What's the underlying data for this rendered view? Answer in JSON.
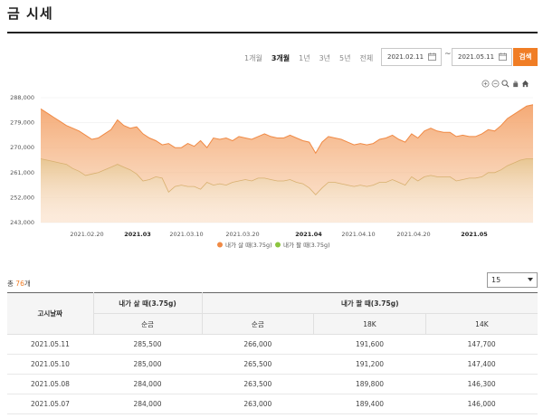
{
  "page": {
    "title": "금 시세"
  },
  "filters": {
    "periods": [
      "1개월",
      "3개월",
      "1년",
      "3년",
      "5년",
      "전체"
    ],
    "active_period": "3개월",
    "start_date": "2021.02.11",
    "end_date": "2021.05.11",
    "separator": "~",
    "search_label": "검색"
  },
  "chart_tools": [
    "zoom-in-icon",
    "zoom-out-icon",
    "magnifier-icon",
    "pan-hand-icon",
    "home-icon"
  ],
  "chart_data": {
    "type": "area",
    "x_tick_labels": [
      "2021.02.20",
      "2021.03",
      "2021.03.10",
      "2021.03.20",
      "2021.04",
      "2021.04.10",
      "2021.04.20",
      "2021.05"
    ],
    "x_tick_bold": [
      false,
      true,
      false,
      false,
      true,
      false,
      false,
      true
    ],
    "y_tick_labels": [
      "288,000",
      "279,000",
      "270,000",
      "261,000",
      "252,000",
      "243,000"
    ],
    "ylim": [
      243000,
      288000
    ],
    "legend_placement": "bottom-center",
    "series": [
      {
        "name": "내가 살 때(3.75g)",
        "color": "#f0a36a",
        "values": [
          284000,
          282500,
          281000,
          279500,
          278000,
          277000,
          276000,
          274500,
          273000,
          273500,
          275000,
          276500,
          280000,
          278000,
          277000,
          277500,
          275000,
          273500,
          272500,
          271000,
          271500,
          270000,
          270000,
          271500,
          270500,
          272500,
          270000,
          273500,
          273000,
          273500,
          272500,
          274000,
          273500,
          273000,
          274000,
          275000,
          274000,
          273500,
          273500,
          274500,
          273500,
          272500,
          272000,
          268000,
          272000,
          274000,
          273500,
          273000,
          272000,
          271000,
          271500,
          271000,
          271500,
          273000,
          273500,
          274500,
          273000,
          272000,
          275000,
          273500,
          276000,
          277000,
          276000,
          275500,
          275500,
          274000,
          274500,
          274000,
          274000,
          275000,
          276500,
          276000,
          278000,
          280500,
          282000,
          283500,
          285000,
          285500
        ]
      },
      {
        "name": "내가 팔 때(3.75g)",
        "color": "#a8d36a",
        "values": [
          266000,
          265500,
          265000,
          264500,
          264000,
          262500,
          261500,
          260000,
          260500,
          261000,
          262000,
          263000,
          264000,
          263000,
          262000,
          260500,
          258000,
          258500,
          259500,
          259000,
          254000,
          256000,
          256500,
          256000,
          256000,
          255000,
          257500,
          256500,
          257000,
          256500,
          257500,
          258000,
          258500,
          258000,
          259000,
          259000,
          258500,
          258000,
          258000,
          258500,
          257500,
          257000,
          255500,
          253000,
          255500,
          257500,
          257500,
          257000,
          256500,
          256000,
          256500,
          256000,
          256500,
          257500,
          257500,
          258500,
          257500,
          256500,
          259500,
          258000,
          259500,
          260000,
          259500,
          259500,
          259500,
          258000,
          258500,
          259000,
          259000,
          259500,
          261000,
          261000,
          262000,
          263500,
          264500,
          265500,
          266000,
          266000
        ]
      }
    ]
  },
  "summary": {
    "total_prefix": "총 ",
    "total_count": "76",
    "total_suffix": "개"
  },
  "page_size": "15",
  "table": {
    "header_date": "고시날짜",
    "header_buy": "내가 살 때(3.75g)",
    "header_sell": "내가 팔 때(3.75g)",
    "sub_headers": [
      "순금",
      "순금",
      "18K",
      "14K"
    ],
    "rows": [
      [
        "2021.05.11",
        "285,500",
        "266,000",
        "191,600",
        "147,700"
      ],
      [
        "2021.05.10",
        "285,000",
        "265,500",
        "191,200",
        "147,400"
      ],
      [
        "2021.05.08",
        "284,000",
        "263,500",
        "189,800",
        "146,300"
      ],
      [
        "2021.05.07",
        "284,000",
        "263,000",
        "189,400",
        "146,000"
      ]
    ]
  }
}
